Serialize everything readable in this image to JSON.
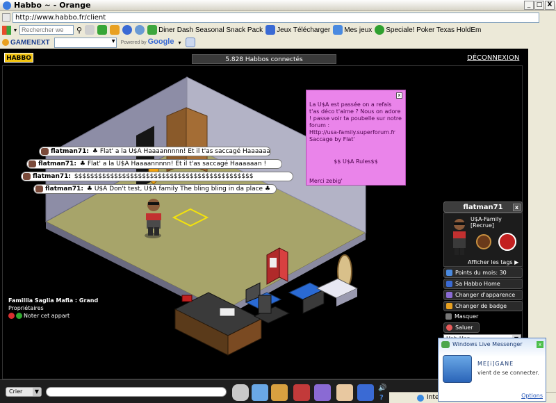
{
  "window": {
    "title": "Habbo ~ - Orange",
    "min": "_",
    "max": "□",
    "close": "X"
  },
  "address": {
    "url": "http://www.habbo.fr/client"
  },
  "toolbar1": {
    "search_placeholder": "Rechercher we",
    "links": [
      "Diner Dash Seasonal Snack Pack",
      "Jeux Télécharger",
      "Mes jeux",
      "Speciale! Poker Texas HoldEm"
    ]
  },
  "toolbar2": {
    "gamenext": "GAMENEXT",
    "powered_by": "Powered by",
    "google": "Google"
  },
  "habbo": {
    "logo": "HABBO",
    "online": "5.828 Habbos connectés",
    "logout": "DÉCONNEXION"
  },
  "chat": [
    {
      "user": "flatman71:",
      "text": "♣ Flat' a la U$A Haaaannnnn! Et il t'as saccagé  Haaaaaan !"
    },
    {
      "user": "flatman71:",
      "text": "♣ Flat' a la U$A Haaaannnnn! Et il t'as saccagé  Haaaaaan !"
    },
    {
      "user": "flatman71:",
      "text": "$$$$$$$$$$$$$$$$$$$$$$$$$$$$$$$$$$$$$$$$$$$$$"
    },
    {
      "user": "flatman71:",
      "text": "♣ U$A Don't test, U$A family The  bling bling in da place ♣"
    }
  ],
  "sticky": {
    "line1": "La U$A est passée on a refais t'as déco  t'aime ?     Nous on adore ! passe voir ta poubelle sur notre forum :",
    "url": "Http://usa-family.superforum.fr",
    "sign": "Saccage by Flat'",
    "rules": "$$      U$A Rules$$",
    "thanks": "Merci zebig'"
  },
  "user_panel": {
    "name": "flatman71",
    "motto": "U$A-Family\n[Recrue]",
    "show_tags": "Afficher les tags",
    "points": "Points du mois: 30",
    "home": "Sa Habbo Home",
    "change_look": "Changer d'apparence",
    "change_badge": "Changer de badge",
    "hide": "Masquer",
    "salute": "Saluer",
    "dance": "Hab-Hop"
  },
  "room_info": {
    "name": "Famillia Saglia Mafia : Grand",
    "owners": "Propriétaires",
    "rate": "Noter cet appart"
  },
  "bottom": {
    "chat_mode": "Crier"
  },
  "status": {
    "zone": "Inte"
  },
  "messenger": {
    "title": "Windows Live Messenger",
    "contact": "ME[i]GANE",
    "message": "vient de se connecter.",
    "options": "Options"
  },
  "colors": {
    "sticky": "#ea84ea",
    "floor": "#a7a46a",
    "wall_left": "#8d8da6",
    "wall_right": "#b3b3c6",
    "logo": "#f2c411"
  }
}
